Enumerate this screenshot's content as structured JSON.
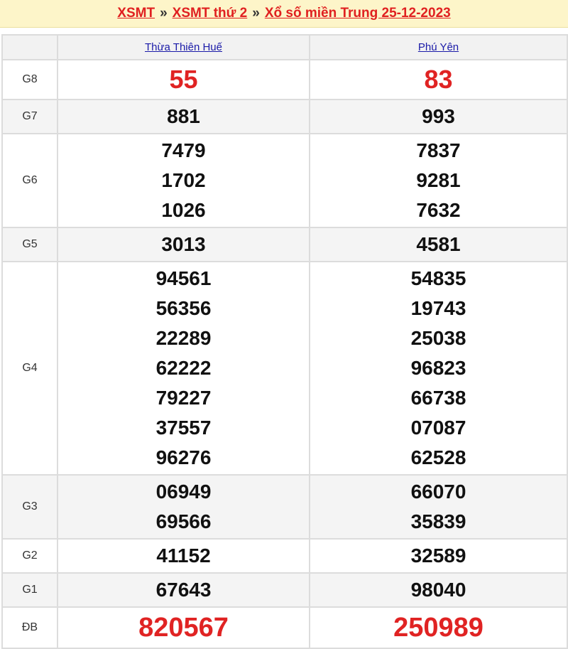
{
  "breadcrumb": {
    "items": [
      "XSMT",
      "XSMT thứ 2",
      "Xổ số miền Trung 25-12-2023"
    ],
    "separator": "»"
  },
  "table": {
    "columns": [
      "Thừa Thiên Huế",
      "Phú Yên"
    ],
    "rows": [
      {
        "label": "G8",
        "col1": [
          "55"
        ],
        "col2": [
          "83"
        ]
      },
      {
        "label": "G7",
        "col1": [
          "881"
        ],
        "col2": [
          "993"
        ]
      },
      {
        "label": "G6",
        "col1": [
          "7479",
          "1702",
          "1026"
        ],
        "col2": [
          "7837",
          "9281",
          "7632"
        ]
      },
      {
        "label": "G5",
        "col1": [
          "3013"
        ],
        "col2": [
          "4581"
        ]
      },
      {
        "label": "G4",
        "col1": [
          "94561",
          "56356",
          "22289",
          "62222",
          "79227",
          "37557",
          "96276"
        ],
        "col2": [
          "54835",
          "19743",
          "25038",
          "96823",
          "66738",
          "07087",
          "62528"
        ]
      },
      {
        "label": "G3",
        "col1": [
          "06949",
          "69566"
        ],
        "col2": [
          "66070",
          "35839"
        ]
      },
      {
        "label": "G2",
        "col1": [
          "41152"
        ],
        "col2": [
          "32589"
        ]
      },
      {
        "label": "G1",
        "col1": [
          "67643"
        ],
        "col2": [
          "98040"
        ]
      },
      {
        "label": "ĐB",
        "col1": [
          "820567"
        ],
        "col2": [
          "250989"
        ]
      }
    ]
  },
  "colors": {
    "accent_red": "#e02323",
    "link_blue": "#1a1aa8",
    "topbar_bg": "#fdf5c9"
  }
}
